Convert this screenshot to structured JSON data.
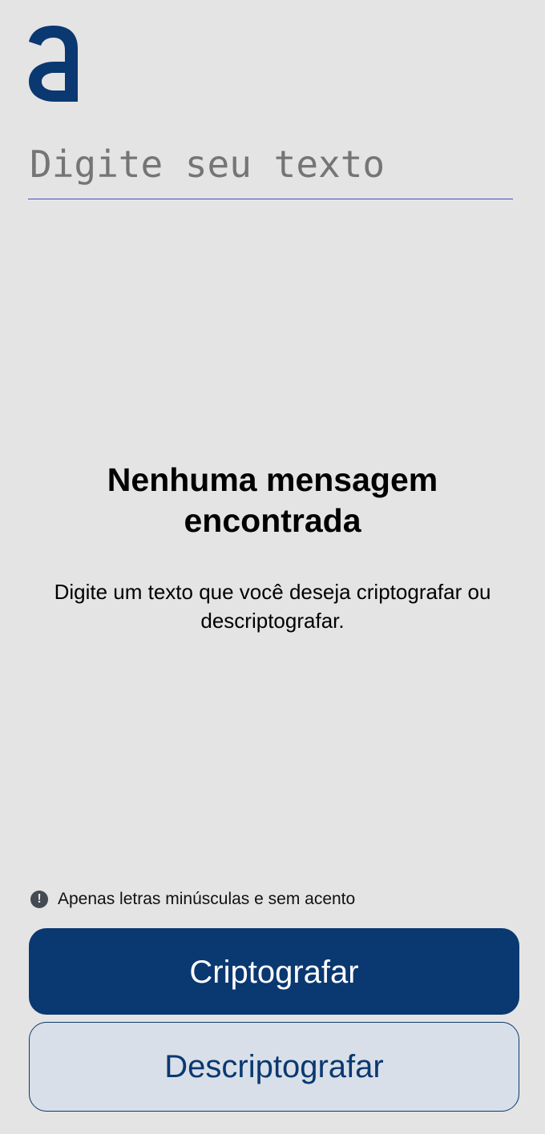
{
  "logo": {
    "icon": "alura-a-logo-icon",
    "color": "#0a3871"
  },
  "input": {
    "placeholder": "Digite seu texto",
    "value": ""
  },
  "empty_state": {
    "title": "Nenhuma mensagem encontrada",
    "description": "Digite um texto que você deseja criptografar ou descriptografar."
  },
  "info": {
    "icon": "exclamation-circle-icon",
    "text": "Apenas letras minúsculas e sem acento"
  },
  "buttons": {
    "encrypt_label": "Criptografar",
    "decrypt_label": "Descriptografar"
  },
  "colors": {
    "background": "#e4e4e4",
    "primary": "#0a3871",
    "secondary_bg": "#d8dfe8",
    "input_underline": "#3b4fd0"
  }
}
